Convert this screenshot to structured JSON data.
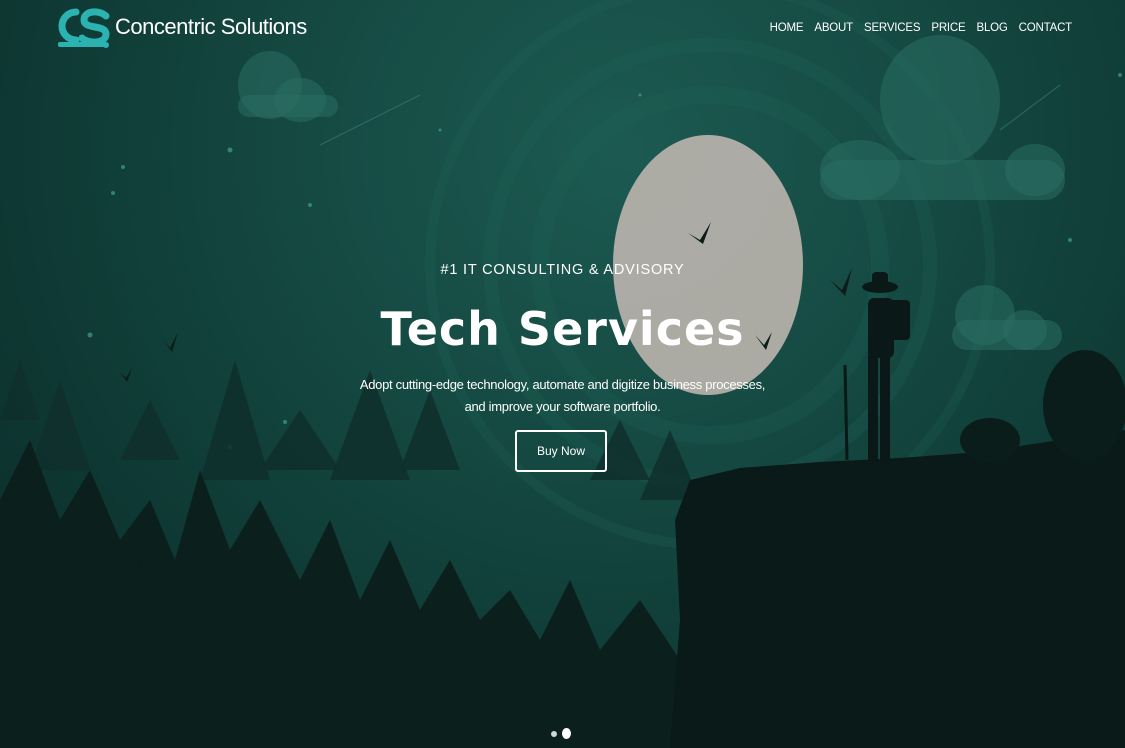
{
  "brand": {
    "name": "Concentric Solutions",
    "logo_icon": "cs-logo-icon",
    "accent_color": "#2bb3b1"
  },
  "nav": {
    "items": [
      "HOME",
      "ABOUT",
      "SERVICES",
      "PRICE",
      "BLOG",
      "CONTACT"
    ]
  },
  "hero": {
    "eyebrow": "#1 IT CONSULTING & ADVISORY",
    "title": "Tech Services",
    "description_line1": "Adopt cutting-edge technology, automate and digitize business processes,",
    "description_line2": "and improve your software portfolio.",
    "button_label": "Buy Now"
  },
  "slider": {
    "slide_count": 2,
    "active_index": 1
  },
  "colors": {
    "background": "#154a43",
    "silhouette": "#0a1f1c",
    "moon": "#b9b3ad",
    "text": "#ffffff"
  }
}
